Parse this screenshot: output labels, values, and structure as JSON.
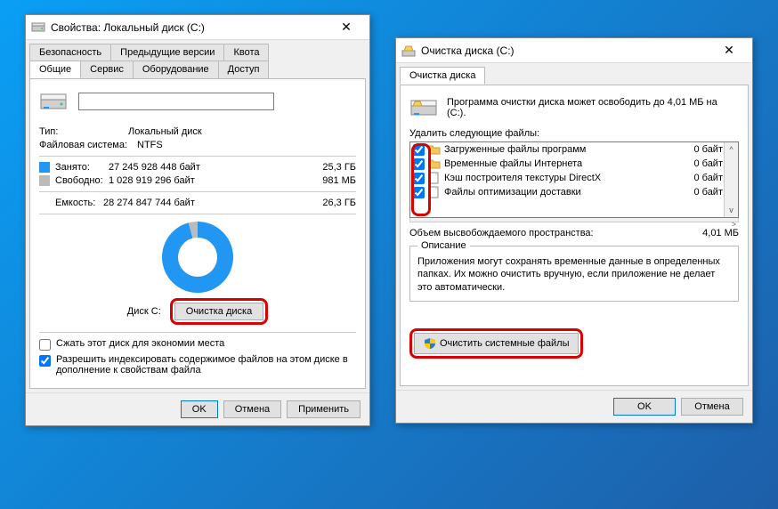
{
  "win1": {
    "title": "Свойства: Локальный диск (C:)",
    "tabs_row1": [
      "Безопасность",
      "Предыдущие версии",
      "Квота"
    ],
    "tabs_row2": [
      "Общие",
      "Сервис",
      "Оборудование",
      "Доступ"
    ],
    "type_label": "Тип:",
    "type_value": "Локальный диск",
    "fs_label": "Файловая система:",
    "fs_value": "NTFS",
    "used_label": "Занято:",
    "used_bytes": "27 245 928 448 байт",
    "used_gb": "25,3 ГБ",
    "free_label": "Свободно:",
    "free_bytes": "1 028 919 296 байт",
    "free_gb": "981 МБ",
    "cap_label": "Емкость:",
    "cap_bytes": "28 274 847 744 байт",
    "cap_gb": "26,3 ГБ",
    "disk_caption": "Диск C:",
    "cleanup_btn": "Очистка диска",
    "compress_label": "Сжать этот диск для экономии места",
    "index_label": "Разрешить индексировать содержимое файлов на этом диске в дополнение к свойствам файла",
    "ok": "OK",
    "cancel": "Отмена",
    "apply": "Применить"
  },
  "win2": {
    "title": "Очистка диска  (C:)",
    "tab": "Очистка диска",
    "summary": "Программа очистки диска может освободить до 4,01 МБ на  (C:).",
    "delete_label": "Удалить следующие файлы:",
    "files": [
      {
        "name": "Загруженные файлы программ",
        "size": "0 байт",
        "checked": true,
        "icon": "folder"
      },
      {
        "name": "Временные файлы Интернета",
        "size": "0 байт",
        "checked": true,
        "icon": "folder"
      },
      {
        "name": "Кэш построителя текстуры DirectX",
        "size": "0 байт",
        "checked": true,
        "icon": "file"
      },
      {
        "name": "Файлы оптимизации доставки",
        "size": "0 байт",
        "checked": true,
        "icon": "file"
      }
    ],
    "freed_label": "Объем высвобождаемого пространства:",
    "freed_value": "4,01 МБ",
    "desc_title": "Описание",
    "desc_text": "Приложения могут сохранять временные данные в определенных папках. Их можно очистить вручную, если приложение не делает это автоматически.",
    "sys_btn": "Очистить системные файлы",
    "ok": "OK",
    "cancel": "Отмена"
  }
}
